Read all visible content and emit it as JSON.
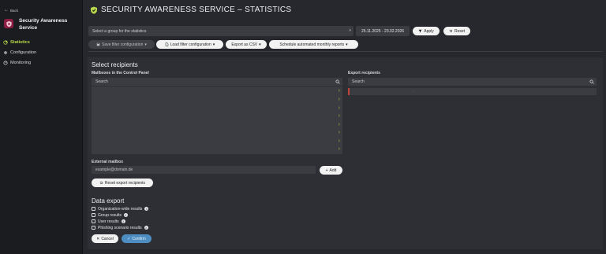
{
  "sidebar": {
    "back_label": "Back",
    "app_title": "Security Awareness Service",
    "items": [
      {
        "label": "Statistics",
        "icon": "chart-pie-icon",
        "active": true
      },
      {
        "label": "Configuration",
        "icon": "gear-icon",
        "active": false
      },
      {
        "label": "Monitoring",
        "icon": "monitor-icon",
        "active": false
      }
    ]
  },
  "header": {
    "title": "SECURITY AWARENESS SERVICE – STATISTICS"
  },
  "filters": {
    "group_select_placeholder": "Select a group for the statistics",
    "date_range": "25.11.2025 - 23.02.2026",
    "apply_label": "Apply",
    "reset_label": "Reset"
  },
  "toolbar": {
    "save_filter_label": "Save filter configuration",
    "load_filter_label": "Load filter configuration",
    "export_csv_label": "Export as CSV",
    "schedule_label": "Schedule automated monthly reports"
  },
  "recipients": {
    "title": "Select recipients",
    "mailboxes_label": "Mailboxes in the Control Panel",
    "mailboxes_search_placeholder": "Search",
    "export_label": "Export recipients",
    "export_search_placeholder": "Search",
    "export_row_text": "-",
    "external_label": "External mailbox",
    "external_placeholder": "example@domain.de",
    "add_label": "Add",
    "reset_export_label": "Reset export recipients"
  },
  "data_export": {
    "title": "Data export",
    "options": [
      {
        "label": "Organization-wide results",
        "checked": false
      },
      {
        "label": "Group results",
        "checked": false
      },
      {
        "label": "User results",
        "checked": false
      },
      {
        "label": "Phishing scenario results",
        "checked": false
      }
    ],
    "cancel_label": "Cancel",
    "confirm_label": "Confirm"
  },
  "colors": {
    "accent_green": "#b7d84a",
    "brand": "#8c1d43",
    "confirm_blue": "#4e8dc2"
  }
}
